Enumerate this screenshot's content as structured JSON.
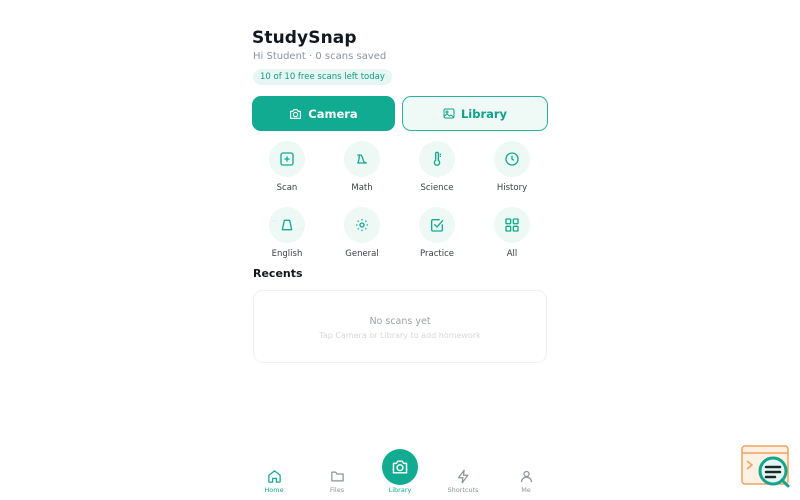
{
  "app": {
    "title": "StudySnap",
    "subtitle": "Hi Student · 0 scans saved",
    "quota_badge": "10 of 10 free scans left today"
  },
  "actions": {
    "camera_label": "Camera",
    "library_label": "Library"
  },
  "categories": [
    {
      "label": "Scan",
      "icon": "plus-square-icon"
    },
    {
      "label": "Math",
      "icon": "math-symbol-icon"
    },
    {
      "label": "Science",
      "icon": "thermometer-icon"
    },
    {
      "label": "History",
      "icon": "clock-icon"
    },
    {
      "label": "English",
      "icon": "bell-shape-icon"
    },
    {
      "label": "General",
      "icon": "sun-icon"
    },
    {
      "label": "Practice",
      "icon": "checkbox-icon"
    },
    {
      "label": "All",
      "icon": "grid-icon"
    }
  ],
  "recents": {
    "heading": "Recents",
    "empty_title": "No scans yet",
    "empty_hint": "Tap Camera or Library to add homework"
  },
  "bottom_nav": {
    "items": [
      {
        "label": "Home",
        "icon": "home-icon",
        "active": true
      },
      {
        "label": "Files",
        "icon": "folder-icon",
        "active": false
      },
      {
        "label": "Library",
        "icon": "camera-icon",
        "active": false
      },
      {
        "label": "Shortcuts",
        "icon": "lightning-icon",
        "active": false
      },
      {
        "label": "Me",
        "icon": "user-icon",
        "active": false
      }
    ]
  },
  "colors": {
    "accent": "#11ab92",
    "accent_light": "#eef8f5",
    "text_dark": "#12181f",
    "text_muted": "#8b949e"
  }
}
